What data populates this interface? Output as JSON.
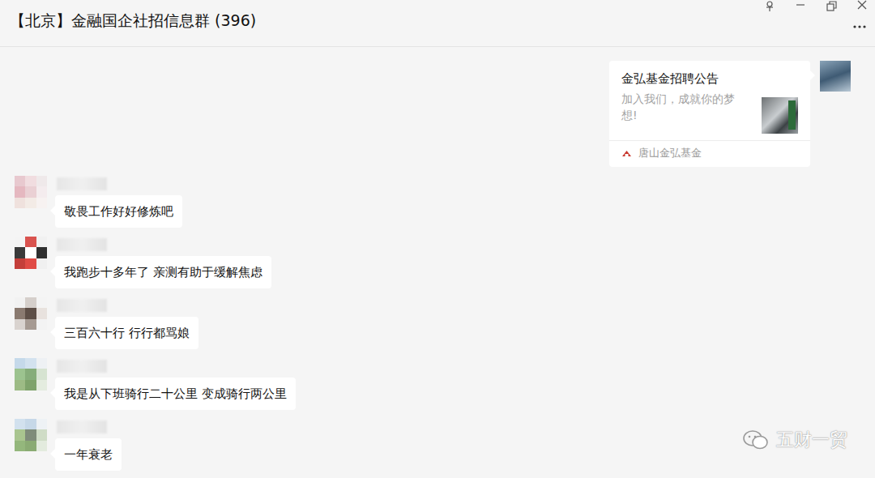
{
  "window": {
    "title": "【北京】金融国企社招信息群 (396)"
  },
  "messages": [
    {
      "kind": "card",
      "title": "金弘基金招聘公告",
      "description": "加入我们，成就你的梦想!",
      "source": "唐山金弘基金"
    },
    {
      "kind": "text",
      "text": "敬畏工作好好修炼吧"
    },
    {
      "kind": "text",
      "text": "我跑步十多年了 亲测有助于缓解焦虑"
    },
    {
      "kind": "text",
      "text": "三百六十行 行行都骂娘"
    },
    {
      "kind": "text",
      "text": "我是从下班骑行二十公里 变成骑行两公里"
    },
    {
      "kind": "text",
      "text": "一年衰老"
    }
  ],
  "watermark": {
    "text": "五财一贸"
  }
}
